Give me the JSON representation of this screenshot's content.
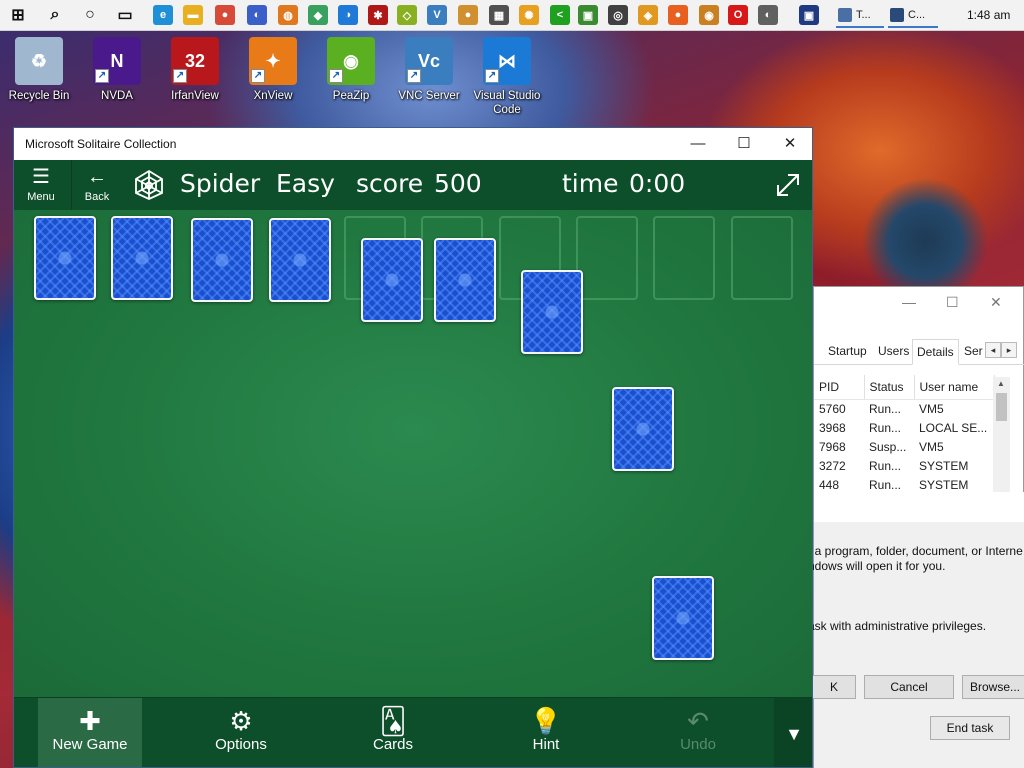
{
  "taskbar": {
    "icons": [
      {
        "name": "start-icon",
        "color": "#1a1a1a",
        "glyph": "⊞"
      },
      {
        "name": "search-icon",
        "color": "#1a1a1a",
        "glyph": "⌕"
      },
      {
        "name": "cortana-icon",
        "color": "#1a1a1a",
        "glyph": "○"
      },
      {
        "name": "task-view-icon",
        "color": "#1a1a1a",
        "glyph": "▭"
      },
      {
        "name": "edge-icon",
        "color": "#1f8fd6",
        "glyph": "e"
      },
      {
        "name": "file-explorer-icon",
        "color": "#e8b020",
        "glyph": "▬"
      },
      {
        "name": "chrome-icon",
        "color": "#d84a38",
        "glyph": "●"
      },
      {
        "name": "app-icon-1",
        "color": "#3a5fc8",
        "glyph": "◐"
      },
      {
        "name": "app-icon-2",
        "color": "#e07820",
        "glyph": "◍"
      },
      {
        "name": "app-icon-3",
        "color": "#3aa060",
        "glyph": "◆"
      },
      {
        "name": "app-icon-4",
        "color": "#1e7ad6",
        "glyph": "◑"
      },
      {
        "name": "irfanview-icon",
        "color": "#b01818",
        "glyph": "✱"
      },
      {
        "name": "app-icon-5",
        "color": "#88b020",
        "glyph": "◇"
      },
      {
        "name": "vnc-icon",
        "color": "#3a7ec0",
        "glyph": "V"
      },
      {
        "name": "app-icon-6",
        "color": "#d09030",
        "glyph": "●"
      },
      {
        "name": "app-icon-7",
        "color": "#505050",
        "glyph": "▦"
      },
      {
        "name": "app-icon-8",
        "color": "#e8a020",
        "glyph": "✺"
      },
      {
        "name": "app-icon-9",
        "color": "#20a020",
        "glyph": "<"
      },
      {
        "name": "app-icon-10",
        "color": "#3a8a30",
        "glyph": "▣"
      },
      {
        "name": "app-icon-11",
        "color": "#404040",
        "glyph": "◎"
      },
      {
        "name": "app-icon-12",
        "color": "#e09820",
        "glyph": "◈"
      },
      {
        "name": "firefox-icon",
        "color": "#e86020",
        "glyph": "●"
      },
      {
        "name": "app-icon-13",
        "color": "#c88020",
        "glyph": "◉"
      },
      {
        "name": "opera-icon",
        "color": "#d81818",
        "glyph": "O"
      },
      {
        "name": "app-icon-14",
        "color": "#606060",
        "glyph": "◐"
      },
      {
        "name": "app-icon-15",
        "color": "#203a80",
        "glyph": "▣"
      }
    ],
    "tasks": [
      {
        "label": "T..."
      },
      {
        "label": "C..."
      }
    ],
    "clock": "1:48 am"
  },
  "desktop_icons": [
    {
      "label": "Recycle Bin",
      "color": "#9fb8d0",
      "glyph": "♻"
    },
    {
      "label": "NVDA",
      "color": "#4a1a8c",
      "glyph": "N"
    },
    {
      "label": "IrfanView",
      "color": "#b8181c",
      "glyph": "32"
    },
    {
      "label": "XnView",
      "color": "#e87a18",
      "glyph": "✦"
    },
    {
      "label": "PeaZip",
      "color": "#5ab020",
      "glyph": "◉"
    },
    {
      "label": "VNC Server",
      "color": "#3a7ec0",
      "glyph": "Vc"
    },
    {
      "label": "Visual Studio Code",
      "color": "#1a7ad6",
      "glyph": "⋈"
    }
  ],
  "task_manager": {
    "tabs": [
      "Startup",
      "Users",
      "Details",
      "Ser"
    ],
    "columns": [
      "PID",
      "Status",
      "User name"
    ],
    "rows": [
      [
        "5760",
        "Run...",
        "VM5"
      ],
      [
        "3968",
        "Run...",
        "LOCAL SE..."
      ],
      [
        "7968",
        "Susp...",
        "VM5"
      ],
      [
        "3272",
        "Run...",
        "SYSTEM"
      ],
      [
        "448",
        "Run...",
        "SYSTEM"
      ]
    ]
  },
  "run_dialog": {
    "line1": "f a program, folder, document, or Interne",
    "line2": "ndows will open it for you.",
    "line3": "ask with administrative privileges.",
    "ok_label": "K",
    "cancel_label": "Cancel",
    "browse_label": "Browse...",
    "end_task_label": "End task"
  },
  "solitaire": {
    "window_title": "Microsoft Solitaire Collection",
    "window_controls": {
      "minimize": "—",
      "maximize": "☐",
      "close": "✕"
    },
    "menu_label": "Menu",
    "back_label": "Back",
    "game_name": "Spider",
    "difficulty": "Easy",
    "score_label": "score",
    "score_value": "500",
    "time_label": "time",
    "time_value": "0:00",
    "colors": {
      "felt": "#20773f",
      "bar": "#0d4f2a",
      "card_back": "#1a4fd0"
    },
    "bottom_bar": {
      "new_game": "New Game",
      "options": "Options",
      "cards": "Cards",
      "hint": "Hint",
      "undo": "Undo"
    }
  }
}
